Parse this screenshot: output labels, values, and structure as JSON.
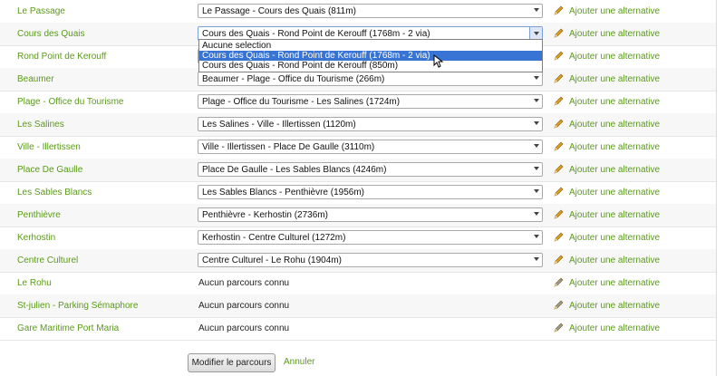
{
  "rows": [
    {
      "stop": "Le Passage",
      "route": "Le Passage - Cours des Quais (811m)",
      "has_route": true
    },
    {
      "stop": "Cours des Quais",
      "route": "Cours des Quais - Rond Point de Kerouff (1768m - 2 via)",
      "has_route": true,
      "open": true
    },
    {
      "stop": "Rond Point de Kerouff",
      "route": "",
      "has_route": true
    },
    {
      "stop": "Beaumer",
      "route": "Beaumer - Plage - Office du Tourisme (266m)",
      "has_route": true
    },
    {
      "stop": "Plage - Office du Tourisme",
      "route": "Plage - Office du Tourisme - Les Salines (1724m)",
      "has_route": true
    },
    {
      "stop": "Les Salines",
      "route": "Les Salines - Ville - Illertissen (1120m)",
      "has_route": true
    },
    {
      "stop": "Ville - Illertissen",
      "route": "Ville - Illertissen - Place De Gaulle (3110m)",
      "has_route": true
    },
    {
      "stop": "Place De Gaulle",
      "route": "Place De Gaulle - Les Sables Blancs (4246m)",
      "has_route": true
    },
    {
      "stop": "Les Sables Blancs",
      "route": "Les Sables Blancs - Penthièvre (1956m)",
      "has_route": true
    },
    {
      "stop": "Penthièvre",
      "route": "Penthièvre - Kerhostin (2736m)",
      "has_route": true
    },
    {
      "stop": "Kerhostin",
      "route": "Kerhostin - Centre Culturel (1272m)",
      "has_route": true
    },
    {
      "stop": "Centre Culturel",
      "route": "Centre Culturel - Le Rohu (1904m)",
      "has_route": true
    },
    {
      "stop": "Le Rohu",
      "route": "",
      "has_route": false
    },
    {
      "stop": "St-julien - Parking Sémaphore",
      "route": "",
      "has_route": false
    },
    {
      "stop": "Gare Maritime Port Maria",
      "route": "",
      "has_route": false
    }
  ],
  "no_route_text": "Aucun parcours connu",
  "alternative_label": "Ajouter une alternative",
  "dropdown": {
    "options": [
      "Aucune selection",
      "Cours des Quais - Rond Point de Kerouff (1768m - 2 via)",
      "Cours des Quais - Rond Point de Kerouff (850m)"
    ],
    "highlighted_index": 1
  },
  "actions": {
    "submit_label": "Modifier le parcours",
    "cancel_label": "Annuler"
  },
  "colors": {
    "link_green": "#5a9a1a",
    "highlight_blue": "#3874d4",
    "pencil_active": "#e0a020",
    "pencil_disabled": "#9a9a9a"
  },
  "icons": {
    "pencil": "pencil-icon",
    "dropdown_arrow": "chevron-down-icon",
    "cursor": "mouse-cursor-icon"
  }
}
